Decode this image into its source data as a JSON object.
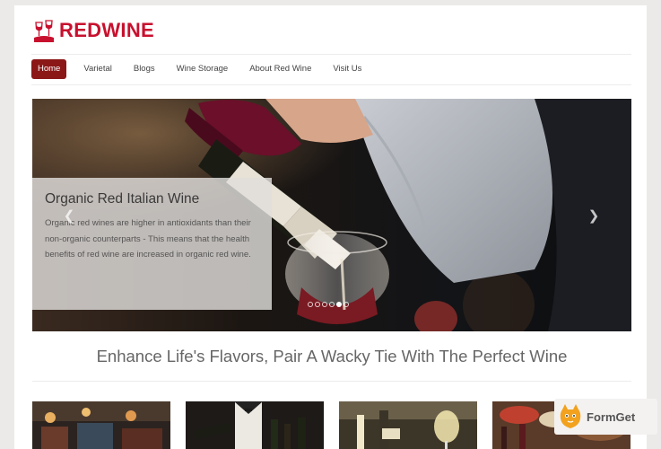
{
  "brand": {
    "name_part1": "RED",
    "name_part2": "WINE"
  },
  "nav": {
    "items": [
      {
        "label": "Home",
        "active": true
      },
      {
        "label": "Varietal"
      },
      {
        "label": "Blogs"
      },
      {
        "label": "Wine Storage"
      },
      {
        "label": "About Red Wine"
      },
      {
        "label": "Visit Us"
      }
    ]
  },
  "hero": {
    "caption_title": "Organic Red Italian Wine",
    "caption_text": "Organic red wines are higher in antioxidants than their non-organic counterparts - This means that the health benefits of red wine are increased in organic red wine.",
    "prev_arrow": "❮",
    "next_arrow": "❯",
    "slides_total": 6,
    "active_slide": 5
  },
  "tagline": "Enhance Life's Flavors, Pair A Wacky Tie With The Perfect Wine",
  "watermark": {
    "label": "FormGet"
  },
  "colors": {
    "accent": "#8b1717",
    "brand_red": "#c8102e"
  }
}
